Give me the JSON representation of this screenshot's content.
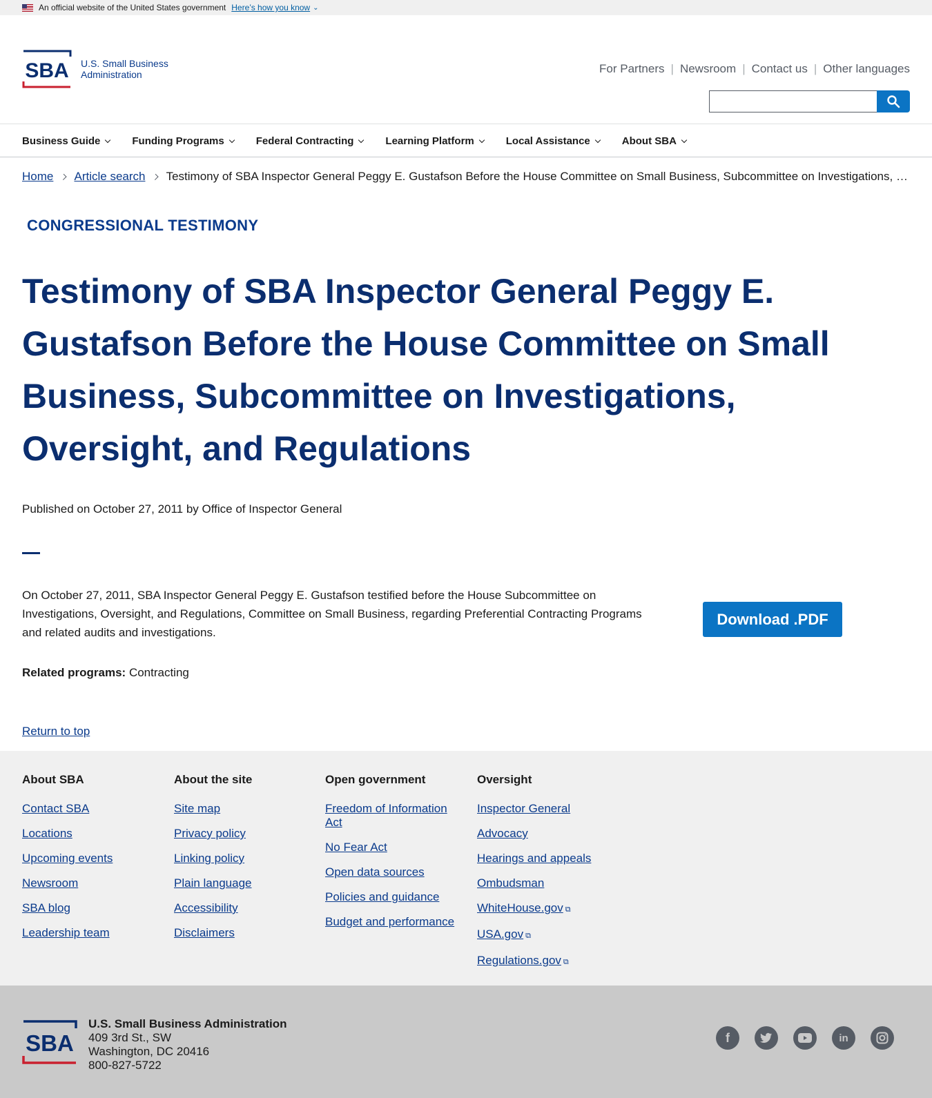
{
  "gov_banner": {
    "text": "An official website of the United States government",
    "how_link": "Here’s how you know"
  },
  "header": {
    "logo_text_line1": "U.S. Small Business",
    "logo_text_line2": "Administration",
    "util_links": [
      "For Partners",
      "Newsroom",
      "Contact us",
      "Other languages"
    ],
    "search_value": ""
  },
  "nav": {
    "items": [
      "Business Guide",
      "Funding Programs",
      "Federal Contracting",
      "Learning Platform",
      "Local Assistance",
      "About SBA"
    ]
  },
  "breadcrumb": {
    "home": "Home",
    "article_search": "Article search",
    "current": "Testimony of SBA Inspector General Peggy E. Gustafson Before the House Committee on Small Business, Subcommittee on Investigations, Oversight, and Regulations"
  },
  "article": {
    "eyebrow": "CONGRESSIONAL TESTIMONY",
    "title": "Testimony of SBA Inspector General Peggy E. Gustafson Before the House Committee on Small Business, Subcommittee on Investigations, Oversight, and Regulations",
    "published": "Published on October 27, 2011 by Office of Inspector General",
    "summary": "On October 27, 2011, SBA Inspector General Peggy E. Gustafson testified before the House Subcommittee on Investigations, Oversight, and Regulations, Committee on Small Business, regarding Preferential Contracting Programs and related audits and investigations.",
    "download_label": "Download .PDF",
    "related_label": "Related programs:",
    "related_value": "Contracting",
    "return_top": "Return to top"
  },
  "footer": {
    "columns": [
      {
        "heading": "About SBA",
        "links": [
          "Contact SBA",
          "Locations",
          "Upcoming events",
          "Newsroom",
          "SBA blog",
          "Leadership team"
        ]
      },
      {
        "heading": "About the site",
        "links": [
          "Site map",
          "Privacy policy",
          "Linking policy",
          "Plain language",
          "Accessibility",
          "Disclaimers"
        ]
      },
      {
        "heading": "Open government",
        "links": [
          "Freedom of Information Act",
          "No Fear Act",
          "Open data sources",
          "Policies and guidance",
          "Budget and performance"
        ]
      },
      {
        "heading": "Oversight",
        "links": [
          "Inspector General",
          "Advocacy",
          "Hearings and appeals",
          "Ombudsman",
          "WhiteHouse.gov",
          "USA.gov",
          "Regulations.gov"
        ]
      }
    ],
    "org_name": "U.S. Small Business Administration",
    "address_line1": "409 3rd St., SW",
    "address_line2": "Washington, DC 20416",
    "phone": "800-827-5722",
    "socials": [
      "facebook-icon",
      "twitter-icon",
      "youtube-icon",
      "linkedin-icon",
      "instagram-icon"
    ]
  },
  "colors": {
    "brand_navy": "#0b2e6f",
    "link_blue": "#0b3b8c",
    "action_blue": "#0b74c4",
    "logo_red": "#c9202f"
  }
}
